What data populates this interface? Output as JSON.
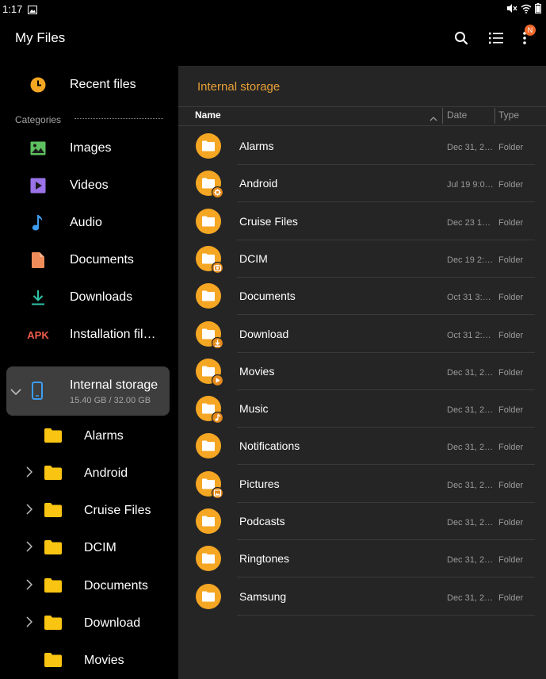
{
  "status": {
    "time": "1:17"
  },
  "app": {
    "title": "My Files",
    "badge": "N",
    "icons": [
      "search-icon",
      "list-view-icon",
      "more-options-icon"
    ]
  },
  "sidebar": {
    "recent": {
      "label": "Recent files",
      "icon": "clock-icon"
    },
    "categories_header": "Categories",
    "categories": [
      {
        "label": "Images",
        "icon": "image-icon",
        "color": "#5ec05e"
      },
      {
        "label": "Videos",
        "icon": "video-icon",
        "color": "#9b73e8"
      },
      {
        "label": "Audio",
        "icon": "music-note-icon",
        "color": "#3d9cf0"
      },
      {
        "label": "Documents",
        "icon": "document-icon",
        "color": "#f08c5a"
      },
      {
        "label": "Downloads",
        "icon": "download-icon",
        "color": "#2ec4a6"
      },
      {
        "label": "Installation fil…",
        "icon": "apk-icon",
        "icon_text": "APK",
        "color": "#ef5b4b"
      }
    ],
    "storage": {
      "title": "Internal storage",
      "usage": "15.40 GB / 32.00 GB",
      "icon": "phone-icon",
      "color": "#3d9cf0"
    },
    "tree": [
      {
        "label": "Alarms",
        "has_children": false
      },
      {
        "label": "Android",
        "has_children": true
      },
      {
        "label": "Cruise Files",
        "has_children": true
      },
      {
        "label": "DCIM",
        "has_children": true
      },
      {
        "label": "Documents",
        "has_children": true
      },
      {
        "label": "Download",
        "has_children": true
      },
      {
        "label": "Movies",
        "has_children": false
      }
    ]
  },
  "main": {
    "title": "Internal storage",
    "columns": {
      "name": "Name",
      "date": "Date",
      "type": "Type"
    },
    "files": [
      {
        "name": "Alarms",
        "date": "Dec 31, 2…",
        "type": "Folder",
        "badge": ""
      },
      {
        "name": "Android",
        "date": "Jul 19 9:0…",
        "type": "Folder",
        "badge": "gear-icon"
      },
      {
        "name": "Cruise Files",
        "date": "Dec 23 1…",
        "type": "Folder",
        "badge": ""
      },
      {
        "name": "DCIM",
        "date": "Dec 19 2:…",
        "type": "Folder",
        "badge": "camera-icon"
      },
      {
        "name": "Documents",
        "date": "Oct 31 3:…",
        "type": "Folder",
        "badge": ""
      },
      {
        "name": "Download",
        "date": "Oct 31 2:…",
        "type": "Folder",
        "badge": "download-icon"
      },
      {
        "name": "Movies",
        "date": "Dec 31, 2…",
        "type": "Folder",
        "badge": "play-icon"
      },
      {
        "name": "Music",
        "date": "Dec 31, 2…",
        "type": "Folder",
        "badge": "music-note-icon"
      },
      {
        "name": "Notifications",
        "date": "Dec 31, 2…",
        "type": "Folder",
        "badge": ""
      },
      {
        "name": "Pictures",
        "date": "Dec 31, 2…",
        "type": "Folder",
        "badge": "image-icon"
      },
      {
        "name": "Podcasts",
        "date": "Dec 31, 2…",
        "type": "Folder",
        "badge": ""
      },
      {
        "name": "Ringtones",
        "date": "Dec 31, 2…",
        "type": "Folder",
        "badge": ""
      },
      {
        "name": "Samsung",
        "date": "Dec 31, 2…",
        "type": "Folder",
        "badge": ""
      }
    ]
  },
  "colors": {
    "accent": "#e8a036",
    "folder": "#f5a623",
    "folder_yellow": "#f9c412",
    "panel": "#252525"
  }
}
